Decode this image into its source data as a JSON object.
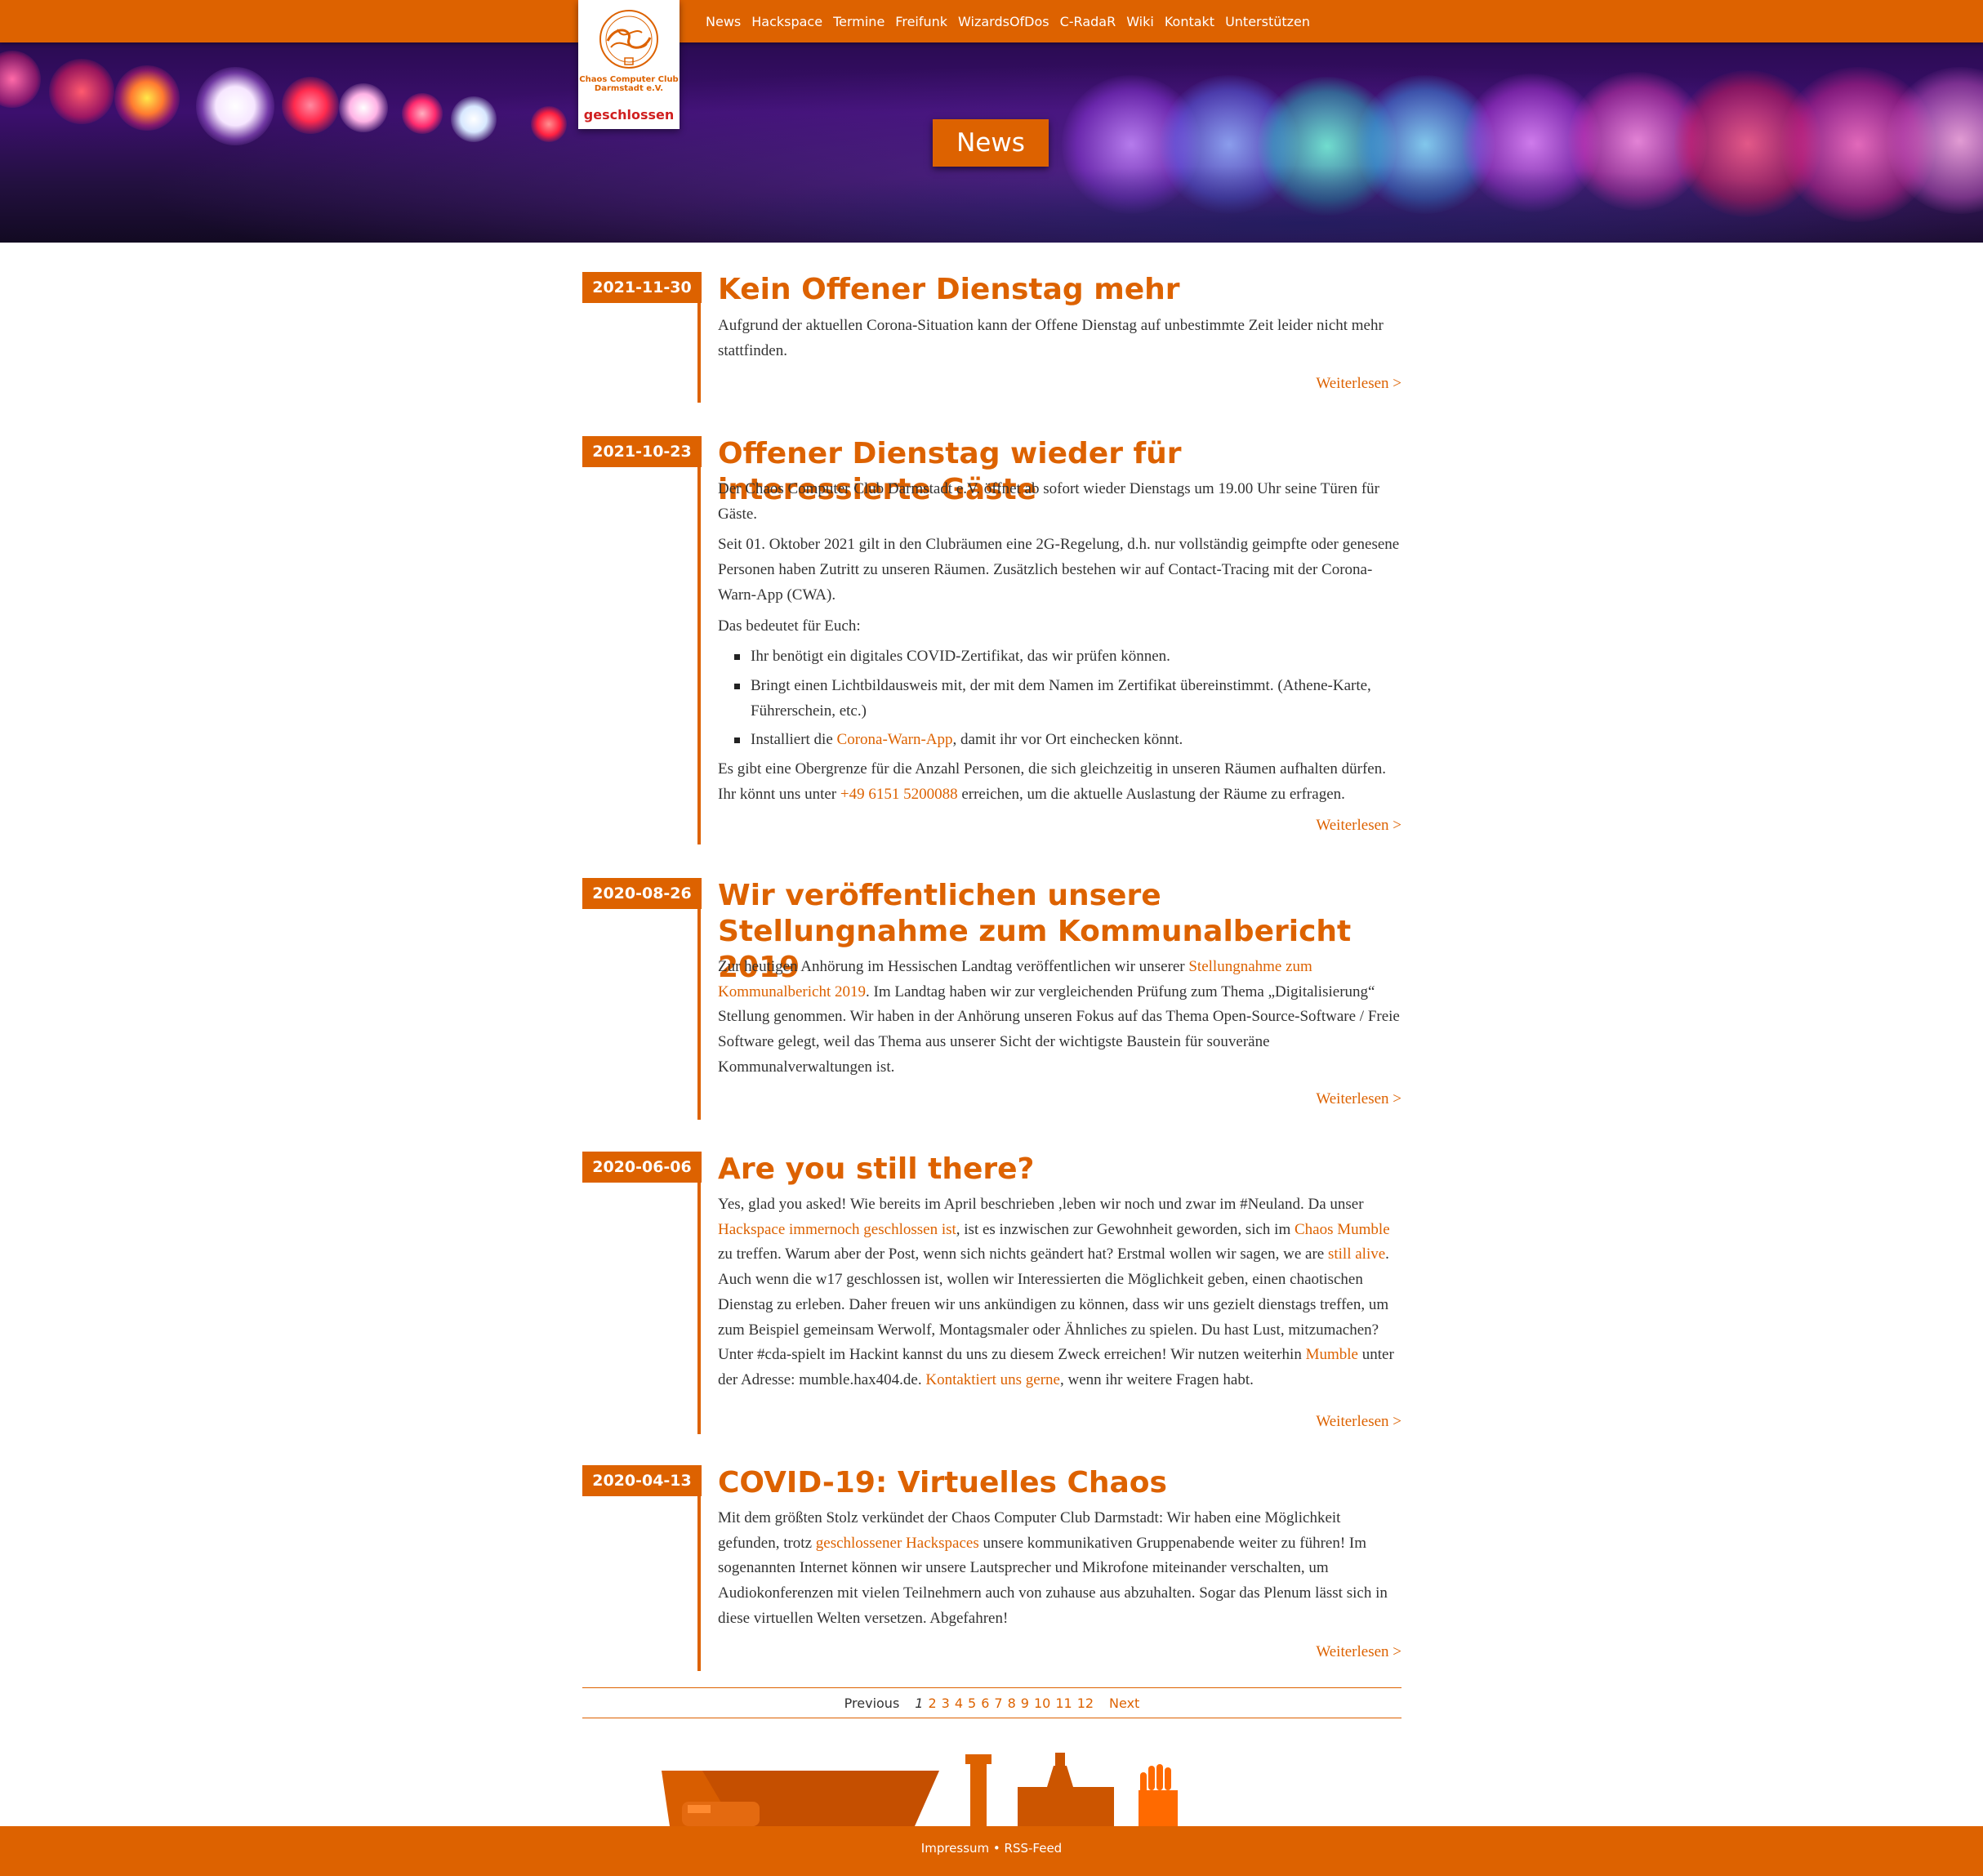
{
  "nav": {
    "items": [
      "News",
      "Hackspace",
      "Termine",
      "Freifunk",
      "WizardsOfDos",
      "C-RadaR",
      "Wiki",
      "Kontakt",
      "Unterstützen"
    ]
  },
  "logo": {
    "name_line1": "Chaos Computer Club",
    "name_line2": "Darmstadt e.V.",
    "status": "geschlossen"
  },
  "hero": {
    "title": "News"
  },
  "posts": [
    {
      "date": "2021-11-30",
      "title": "Kein Offener Dienstag mehr",
      "p1": "Aufgrund der aktuellen Corona-Situation kann der Offene Dienstag auf unbestimmte Zeit leider nicht mehr stattfinden.",
      "more": "Weiterlesen >"
    },
    {
      "date": "2021-10-23",
      "title": "Offener Dienstag wieder für interessierte Gäste",
      "p1": "Der Chaos Computer Club Darmstadt e.V. öffnet ab sofort wieder Dienstags um 19.00 Uhr seine Türen für Gäste.",
      "p2": "Seit 01. Oktober 2021 gilt in den Clubräumen eine 2G-Regelung, d.h. nur vollständig geimpfte oder genesene Personen haben Zutritt zu unseren Räumen. Zusätzlich bestehen wir auf Contact-Tracing mit der Corona-Warn-App (CWA).",
      "p3": "Das bedeutet für Euch:",
      "li1": "Ihr benötigt ein digitales COVID-Zertifikat, das wir prüfen können.",
      "li2": "Bringt einen Lichtbildausweis mit, der mit dem Namen im Zertifikat übereinstimmt. (Athene-Karte, Führerschein, etc.)",
      "li3_pre": "Installiert die ",
      "li3_link": "Corona-Warn-App",
      "li3_post": ", damit ihr vor Ort einchecken könnt.",
      "p4_pre": "Es gibt eine Obergrenze für die Anzahl Personen, die sich gleichzeitig in unseren Räumen aufhalten dürfen. Ihr könnt uns unter ",
      "p4_link": "+49 6151 5200088",
      "p4_post": " erreichen, um die aktuelle Auslastung der Räume zu erfragen.",
      "more": "Weiterlesen >"
    },
    {
      "date": "2020-08-26",
      "title": "Wir veröffentlichen unsere Stellungnahme zum Kommunalbericht 2019",
      "p1_pre": "Zur heutigen Anhörung im Hessischen Landtag veröffentlichen wir unserer ",
      "p1_link": "Stellungnahme zum Kommunalbericht 2019",
      "p1_post": ". Im Landtag haben wir zur vergleichenden Prüfung zum Thema „Digitalisierung“ Stellung genommen. Wir haben in der Anhörung unseren Fokus auf das Thema Open-Source-Software / Freie Software gelegt, weil das Thema aus unserer Sicht der wichtigste Baustein für souveräne Kommunalverwaltungen ist.",
      "more": "Weiterlesen >"
    },
    {
      "date": "2020-06-06",
      "title": "Are you still there?",
      "t1": "Yes, glad you asked! Wie bereits im April beschrieben ,leben wir noch und zwar im #Neuland. Da unser ",
      "l1": "Hackspace immernoch geschlossen ist",
      "t2": ", ist es inzwischen zur Gewohnheit geworden, sich im ",
      "l2": "Chaos Mumble",
      "t3": " zu treffen. Warum aber der Post, wenn sich nichts geändert hat? Erstmal wollen wir sagen, we are ",
      "l3": "still alive",
      "t4": ". Auch wenn die w17 geschlossen ist, wollen wir Interessierten die Möglichkeit geben, einen chaotischen Dienstag zu erleben. Daher freuen wir uns ankündigen zu können, dass wir uns gezielt dienstags treffen, um zum Beispiel gemeinsam Werwolf, Montagsmaler oder Ähnliches zu spielen. Du hast Lust, mitzumachen? Unter #cda-spielt im Hackint kannst du uns zu diesem Zweck erreichen! Wir nutzen weiterhin ",
      "l4": "Mumble",
      "t5": " unter der Adresse: mumble.hax404.de. ",
      "l5": "Kontaktiert uns gerne",
      "t6": ", wenn ihr weitere Fragen habt.",
      "more": "Weiterlesen >"
    },
    {
      "date": "2020-04-13",
      "title": "COVID-19: Virtuelles Chaos",
      "t1": "Mit dem größten Stolz verkündet der Chaos Computer Club Darmstadt: Wir haben eine Möglichkeit gefunden, trotz ",
      "l1": "geschlossener Hackspaces",
      "t2": " unsere kommunikativen Gruppenabende weiter zu führen! Im sogenannten Internet können wir unsere Lautsprecher und Mikrofone miteinander verschalten, um Audiokonferenzen mit vielen Teilnehmern auch von zuhause aus abzuhalten. Sogar das Plenum lässt sich in diese virtuellen Welten versetzen. Abgefahren!",
      "more": "Weiterlesen >"
    }
  ],
  "pagination": {
    "previous": "Previous",
    "current": "1",
    "pages": [
      "2",
      "3",
      "4",
      "5",
      "6",
      "7",
      "8",
      "9",
      "10",
      "11",
      "12"
    ],
    "next": "Next"
  },
  "footer": {
    "text": "Impressum • RSS-Feed"
  },
  "colors": {
    "accent": "#dd6200",
    "status_closed": "#d01f1f"
  }
}
